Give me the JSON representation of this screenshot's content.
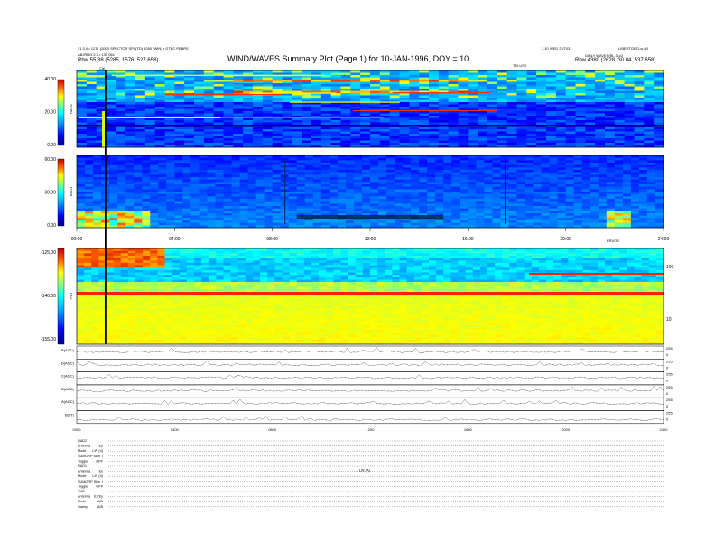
{
  "header": {
    "info_line1": "31 3.0 • 1271 (2000 SPECTOR SPI (TD) 1050 (WIN) • GTBC PEBPE",
    "info_line2": "ABJRRG 2.3 • 130 061",
    "rbw_left": "Rbw   55.38 (5285, 1576, 527 658)",
    "title": "WIND/WAVES Summary Plot (Page 1) for 10-JAN-1996, DOY = 10",
    "label_center": "TELUSE",
    "right_top1": "1.10 WED 2UT03",
    "right_top2": "LIBERTGRO-w 80",
    "right_top3": "DAILY WAVES(BL 3Lx2",
    "rbw_right": "Rbw   4380 (2628, 30.04, 537 658)",
    "cal_label": "Cal"
  },
  "panel_labels": {
    "rad2": "RAD2",
    "rad1": "RAD1",
    "tnr": "TNR"
  },
  "time_axis": {
    "ticks": [
      "00:00",
      "04:00",
      "08:00",
      "12:00",
      "16:00",
      "20:00",
      "24:00"
    ],
    "right_label": "ERVOS"
  },
  "lower_time_axis": {
    "ticks": [
      "0000",
      "0400",
      "0800",
      "1200",
      "1600",
      "2000",
      "2400"
    ]
  },
  "chart_data": [
    {
      "type": "heatmap",
      "panel": "RAD2",
      "y_ticks": [
        "40.00",
        "20.00",
        "0.00"
      ],
      "ylim": [
        0,
        40
      ],
      "xlim": [
        0,
        24
      ]
    },
    {
      "type": "heatmap",
      "panel": "RAD1",
      "y_ticks": [
        "60.00",
        "30.00",
        "0.00"
      ],
      "ylim": [
        0,
        60
      ],
      "xlim": [
        0,
        24
      ]
    },
    {
      "type": "heatmap",
      "panel": "TNR",
      "y_ticks": [
        "-125.00",
        "-140.00",
        "-155.00"
      ],
      "ylim": [
        -155,
        -125
      ],
      "right_ticks": [
        "100",
        "10"
      ],
      "xlim": [
        0,
        24
      ]
    },
    {
      "type": "line",
      "panel": "strip-charts",
      "series_labels": [
        "B(AGC)",
        "D(AGC)",
        "C(AGC)",
        "B(AGC)",
        "A(AGC)",
        "B(I/T)"
      ],
      "right_ticks": [
        "255",
        "0"
      ],
      "xlim": [
        0,
        24
      ]
    }
  ],
  "footer": {
    "center_label": "US (A)",
    "rows": [
      {
        "label": "RAD2",
        "value": ""
      },
      {
        "label": "Antenna",
        "value": "Ey"
      },
      {
        "label": "Mode",
        "value": "LIN (4)"
      },
      {
        "label": "SUMORP SLin",
        "value": "I"
      },
      {
        "label": "Toggle",
        "value": "OFF"
      },
      {
        "label": "RAD1",
        "value": ""
      },
      {
        "label": "Antenna",
        "value": "Ey"
      },
      {
        "label": "Mode",
        "value": "LIN (4)"
      },
      {
        "label": "SUMORP SLin",
        "value": "I"
      },
      {
        "label": "Toggle",
        "value": "OFF"
      },
      {
        "label": "TNR",
        "value": ""
      },
      {
        "label": "Antenna",
        "value": "Ex/Ey"
      },
      {
        "label": "Mode",
        "value": "A/B"
      },
      {
        "label": "Sweep",
        "value": "A/B"
      }
    ]
  },
  "colors": {
    "spectrum": [
      "#00008f",
      "#0000ff",
      "#0080ff",
      "#00ffff",
      "#80ff80",
      "#ffff00",
      "#ff8000",
      "#ff0000",
      "#800000"
    ]
  }
}
